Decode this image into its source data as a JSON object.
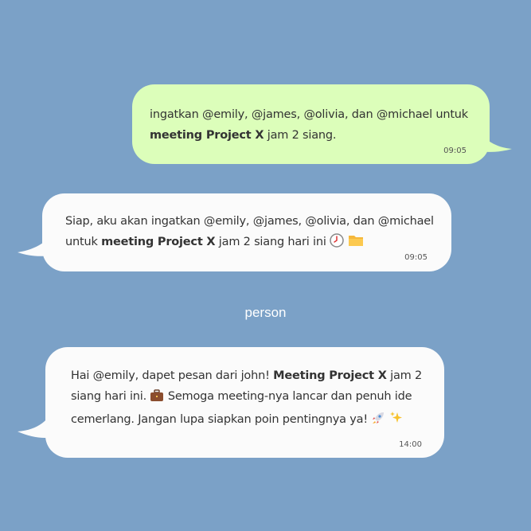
{
  "chat": {
    "messages": [
      {
        "direction": "outgoing",
        "text_part1": "ingatkan @emily, @james, @olivia, dan @michael untuk ",
        "text_bold": "meeting Project X",
        "text_part2": " jam 2 siang.",
        "time": "09:05"
      },
      {
        "direction": "incoming",
        "text_part1": "Siap, aku akan ingatkan @emily, @james, @olivia, dan @michael untuk ",
        "text_bold": "meeting Project X",
        "text_part2": " jam 2 siang hari ini",
        "emojis": [
          "clock-icon",
          "folder-icon"
        ],
        "time": "09:05"
      },
      {
        "direction": "incoming",
        "sender": "person",
        "text_part1": "Hai @emily, dapet pesan dari john! ",
        "text_bold": "Meeting Project X",
        "text_part2": " jam 2 siang hari ini. ",
        "text_part3": " Semoga meeting-nya lancar dan penuh ide cemerlang. Jangan lupa siapkan poin pentingnya ya! ",
        "emojis": [
          "briefcase-icon",
          "rocket-icon",
          "sparkles-icon"
        ],
        "time": "14:00"
      }
    ]
  },
  "colors": {
    "background": "#7ba1c7",
    "outgoing_bubble": "#dcfeba",
    "incoming_bubble": "#fbfbfb",
    "sender_name": "#ffffff"
  }
}
